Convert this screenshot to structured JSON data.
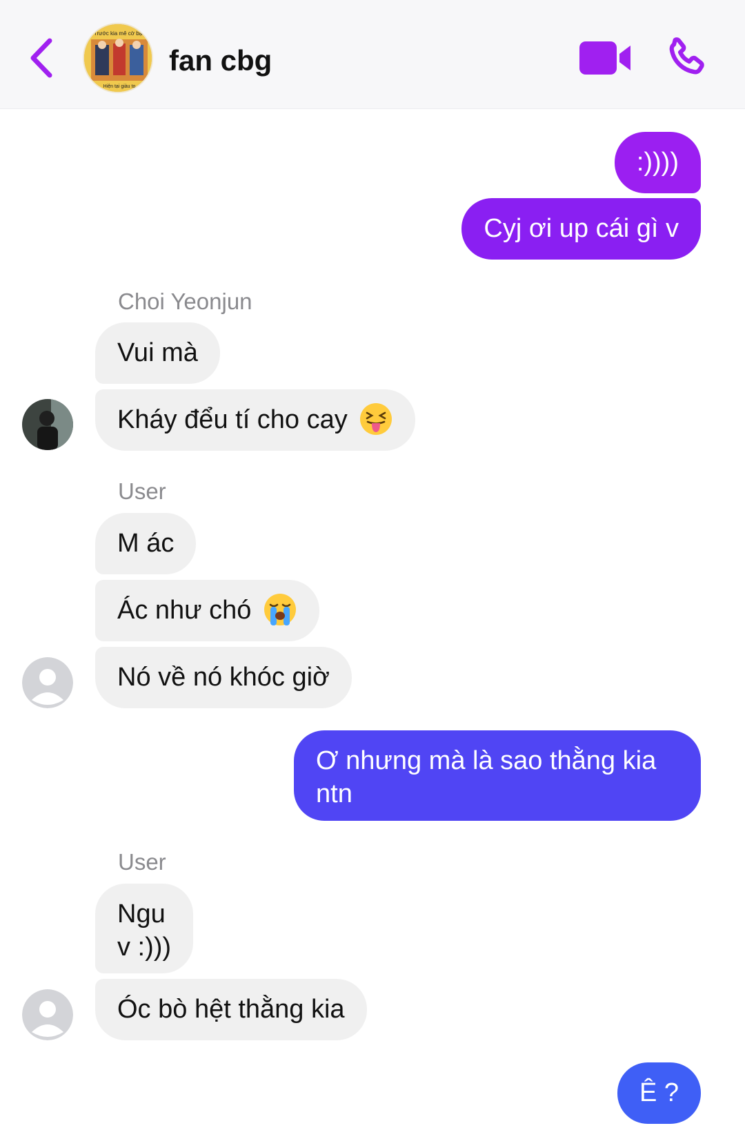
{
  "header": {
    "title": "fan cbg",
    "back_icon": "chevron-left-icon",
    "video_icon": "video-camera-icon",
    "phone_icon": "phone-icon",
    "accent_color": "#a020f0",
    "avatar_caption_top": "Trước kia mê cờ bạc",
    "avatar_caption_bottom": "Hiện tại giàu to"
  },
  "messages": {
    "m1": ":))))",
    "m2": "Cyj ơi up cái gì v",
    "sender1": "Choi Yeonjun",
    "m3": "Vui mà",
    "m4": "Kháy đểu tí cho cay",
    "sender2": "User",
    "m5": "M ác",
    "m6": "Ác như chó",
    "m7": "Nó về nó khóc giờ",
    "m8_line1": "Ơ nhưng mà là sao thằng kia",
    "m8_line2": "ntn",
    "sender3": "User",
    "m9_line1": "Ngu",
    "m9_line2": "v :)))",
    "m10": "Óc bò hệt thằng kia",
    "m11": "Ê ?"
  },
  "colors": {
    "outgoing_purple": "#9b1ff1",
    "outgoing_violet": "#6a2cf2",
    "outgoing_blue": "#4f46f5",
    "outgoing_blue_bottom": "#3f5ff6",
    "incoming_gray": "#f0f0f0",
    "sender_gray": "#8a8a8e"
  }
}
